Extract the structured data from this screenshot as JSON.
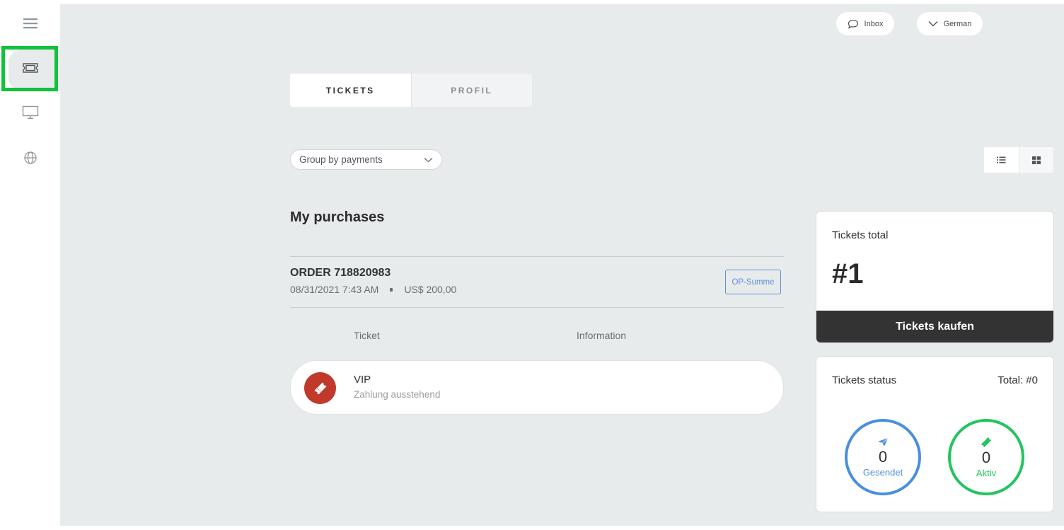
{
  "header": {
    "inbox_label": "Inbox",
    "language_label": "German"
  },
  "tabs": [
    {
      "label": "TICKETS",
      "active": true
    },
    {
      "label": "PROFIL",
      "active": false
    }
  ],
  "group_select": {
    "value": "Group by payments"
  },
  "section_title": "My purchases",
  "order": {
    "title": "ORDER 718820983",
    "datetime": "08/31/2021 7:43 AM",
    "amount": "US$ 200,00",
    "badge": "OP-Summe"
  },
  "columns": {
    "ticket": "Ticket",
    "information": "Information"
  },
  "ticket": {
    "name": "VIP",
    "status": "Zahlung ausstehend",
    "icon": "ticket-icon",
    "icon_color": "#c0392b"
  },
  "tickets_total": {
    "label": "Tickets total",
    "value": "#1",
    "button": "Tickets kaufen"
  },
  "tickets_status": {
    "label": "Tickets status",
    "total": "Total: #0",
    "sent": {
      "value": "0",
      "caption": "Gesendet",
      "color": "#4a8fdd",
      "icon": "paper-plane-icon"
    },
    "active": {
      "value": "0",
      "caption": "Aktiv",
      "color": "#22c55e",
      "icon": "ticket-icon"
    }
  },
  "sidebar": {
    "items": [
      {
        "icon": "menu-icon"
      },
      {
        "icon": "ticket-icon",
        "selected": true
      },
      {
        "icon": "monitor-icon"
      },
      {
        "icon": "globe-icon"
      }
    ],
    "highlight_color": "#12c13c"
  }
}
